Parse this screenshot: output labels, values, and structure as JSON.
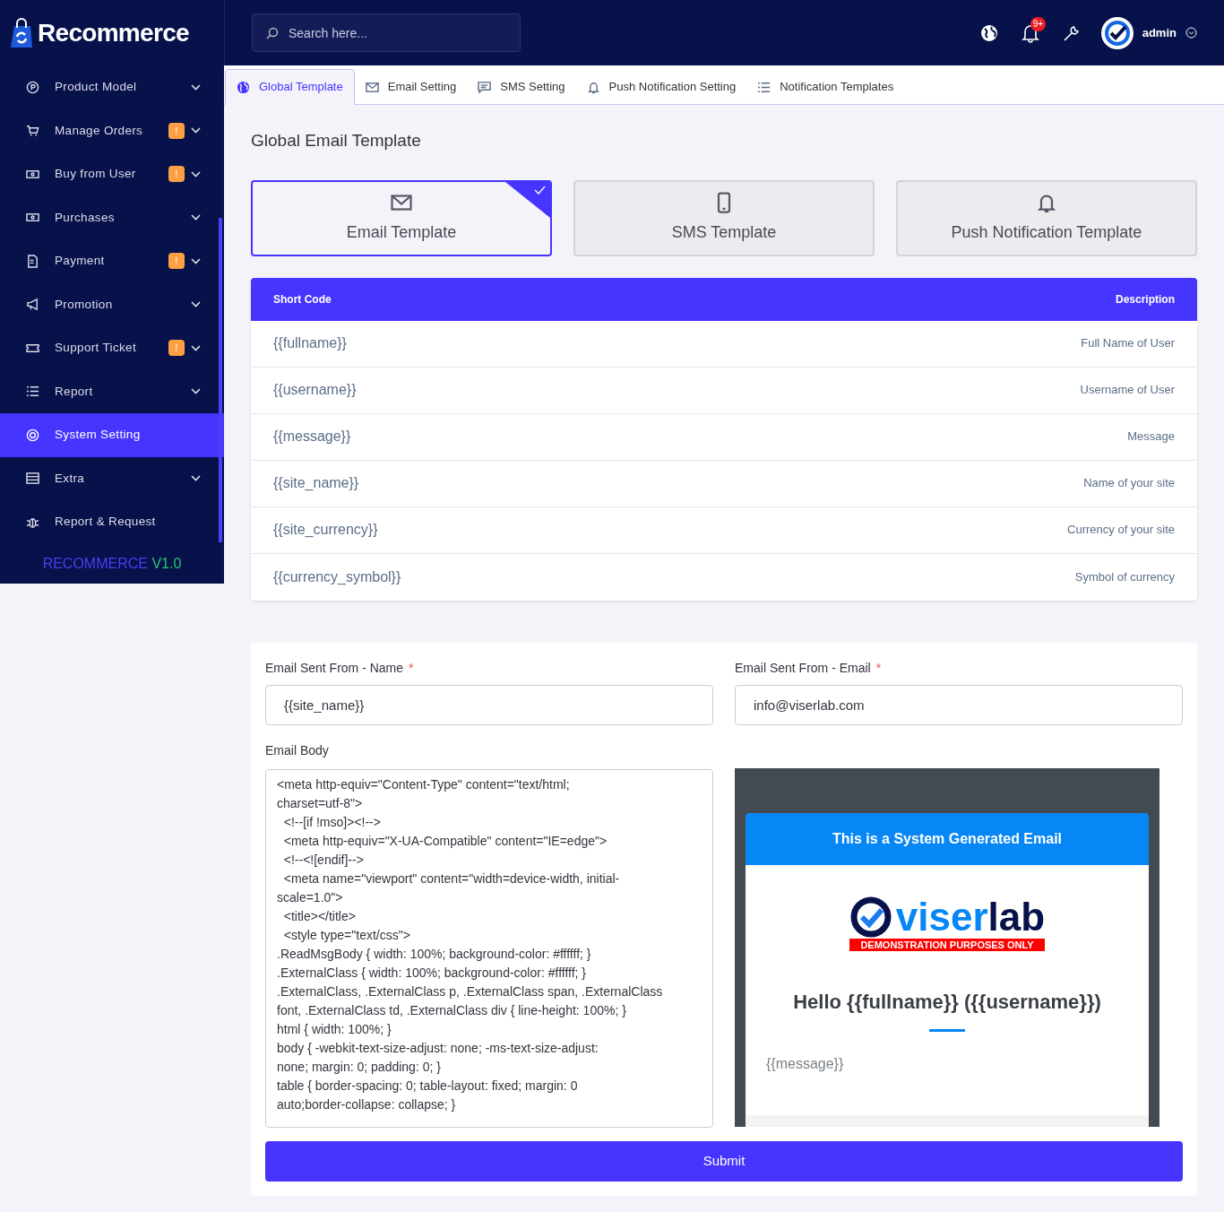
{
  "brand": {
    "name": "Recommerce",
    "version_name": "RECOMMERCE",
    "version_number": "V1.0"
  },
  "sidebar": {
    "items": [
      {
        "label": "Product Model",
        "expandable": true,
        "selected": false
      },
      {
        "label": "Manage Orders",
        "badge": "!",
        "expandable": true,
        "selected": false
      },
      {
        "label": "Buy from User",
        "badge": "!",
        "expandable": true,
        "selected": false
      },
      {
        "label": "Purchases",
        "expandable": true,
        "selected": false
      },
      {
        "label": "Payment",
        "badge": "!",
        "expandable": true,
        "selected": false
      },
      {
        "label": "Promotion",
        "expandable": true,
        "selected": false
      },
      {
        "label": "Support Ticket",
        "badge": "!",
        "expandable": true,
        "selected": false
      },
      {
        "label": "Report",
        "expandable": true,
        "selected": false
      },
      {
        "label": "System Setting",
        "expandable": false,
        "selected": true
      },
      {
        "label": "Extra",
        "expandable": true,
        "selected": false
      },
      {
        "label": "Report & Request",
        "expandable": false,
        "selected": false
      }
    ]
  },
  "topbar": {
    "search": {
      "placeholder": "Search here..."
    },
    "notification_count": "9+",
    "user": "admin"
  },
  "tabs": [
    {
      "label": "Global Template",
      "selected": true
    },
    {
      "label": "Email Setting",
      "selected": false
    },
    {
      "label": "SMS Setting",
      "selected": false
    },
    {
      "label": "Push Notification Setting",
      "selected": false
    },
    {
      "label": "Notification Templates",
      "selected": false
    }
  ],
  "page_title": "Global Email Template",
  "template_cards": [
    {
      "label": "Email Template",
      "selected": true
    },
    {
      "label": "SMS Template",
      "selected": false
    },
    {
      "label": "Push Notification Template",
      "selected": false
    }
  ],
  "table": {
    "columns": [
      "Short Code",
      "Description"
    ],
    "rows": [
      [
        "{{fullname}}",
        "Full Name of User"
      ],
      [
        "{{username}}",
        "Username of User"
      ],
      [
        "{{message}}",
        "Message"
      ],
      [
        "{{site_name}}",
        "Name of your site"
      ],
      [
        "{{site_currency}}",
        "Currency of your site"
      ],
      [
        "{{currency_symbol}}",
        "Symbol of currency"
      ]
    ]
  },
  "form": {
    "fields": [
      {
        "label": "Email Sent From - Name",
        "required_mark": "*",
        "value": "{{site_name}}"
      },
      {
        "label": "Email Sent From - Email",
        "required_mark": "*",
        "value": "info@viserlab.com"
      }
    ],
    "body_label": "Email Body",
    "body_lines": [
      "<meta http-equiv=\"Content-Type\" content=\"text/html;",
      "charset=utf-8\">",
      "  <!--[if !mso]><!-->",
      "  <meta http-equiv=\"X-UA-Compatible\" content=\"IE=edge\">",
      "  <!--<![endif]-->",
      "  <meta name=\"viewport\" content=\"width=device-width, initial-",
      "scale=1.0\">",
      "  <title></title>",
      "  <style type=\"text/css\">",
      ".ReadMsgBody { width: 100%; background-color: #ffffff; }",
      ".ExternalClass { width: 100%; background-color: #ffffff; }",
      ".ExternalClass, .ExternalClass p, .ExternalClass span, .ExternalClass",
      "font, .ExternalClass td, .ExternalClass div { line-height: 100%; }",
      "html { width: 100%; }",
      "body { -webkit-text-size-adjust: none; -ms-text-size-adjust:",
      "none; margin: 0; padding: 0; }",
      "table { border-spacing: 0; table-layout: fixed; margin: 0",
      "auto;border-collapse: collapse; }"
    ],
    "preview": {
      "header": "This is a System Generated Email",
      "logo_word_1": "viser",
      "logo_word_2": "lab",
      "logo_banner": "DEMONSTRATION PURPOSES ONLY",
      "greeting": "Hello {{fullname}} ({{username}})",
      "message": "{{message}}"
    },
    "submit": "Submit"
  }
}
